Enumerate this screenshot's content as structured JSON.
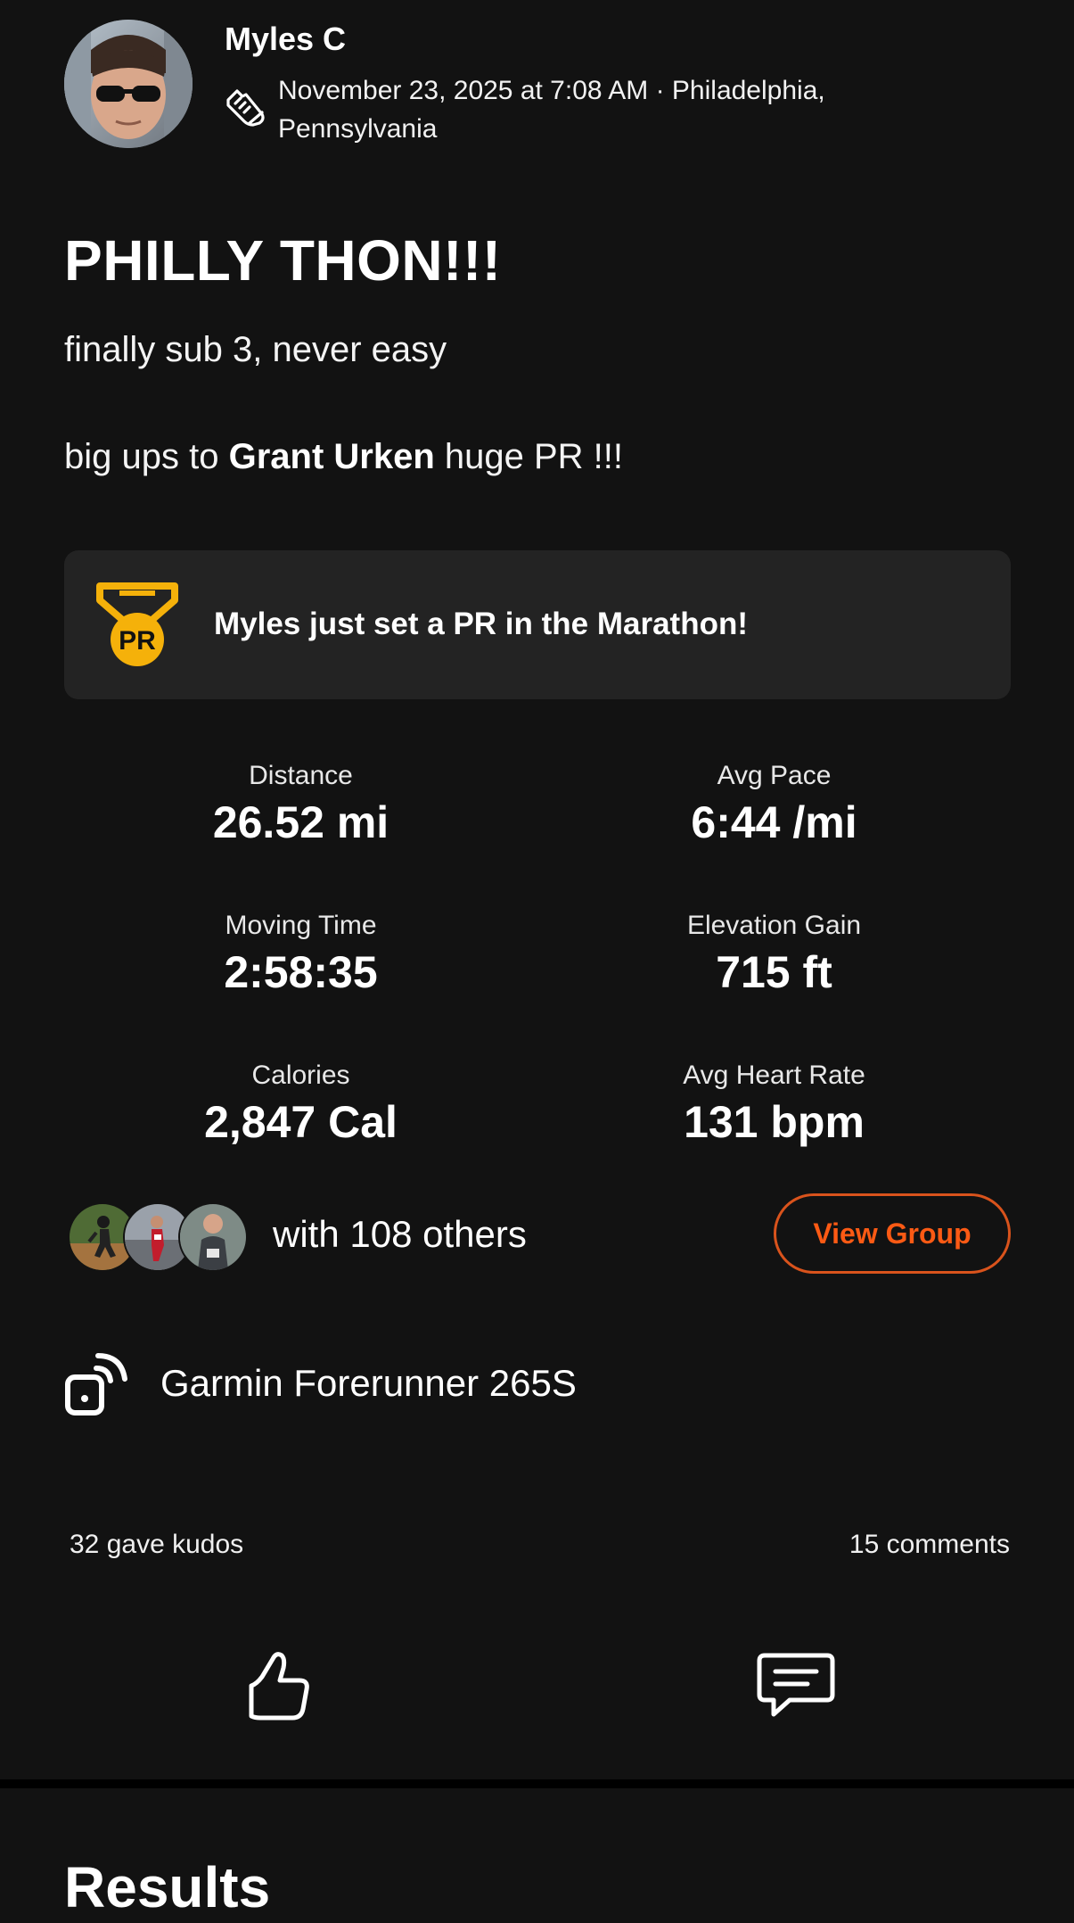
{
  "activity": {
    "athlete_name": "Myles C",
    "datetime_location": "November 23, 2025 at 7:08 AM · Philadelphia, Pennsylvania",
    "title": "PHILLY THON!!!",
    "description_line1": "finally sub 3, never easy",
    "description_line2_prefix": "big ups to ",
    "description_line2_mention": "Grant Urken",
    "description_line2_suffix": " huge PR !!!"
  },
  "pr_card": {
    "badge_text": "PR",
    "message": "Myles just set a PR in the Marathon!",
    "accent_color": "#f5b10a"
  },
  "stats": [
    {
      "label": "Distance",
      "value": "26.52 mi"
    },
    {
      "label": "Avg Pace",
      "value": "6:44 /mi"
    },
    {
      "label": "Moving Time",
      "value": "2:58:35"
    },
    {
      "label": "Elevation Gain",
      "value": "715 ft"
    },
    {
      "label": "Calories",
      "value": "2,847 Cal"
    },
    {
      "label": "Avg Heart Rate",
      "value": "131 bpm"
    }
  ],
  "group": {
    "others_text": "with 108 others",
    "view_group_label": "View Group",
    "accent_color": "#fc5a14"
  },
  "device": {
    "name": "Garmin Forerunner 265S",
    "icon": "device-signal-icon"
  },
  "social": {
    "kudos_text": "32 gave kudos",
    "comments_text": "15 comments",
    "kudos_icon": "thumbs-up-icon",
    "comment_icon": "comment-icon"
  },
  "results": {
    "heading": "Results"
  }
}
